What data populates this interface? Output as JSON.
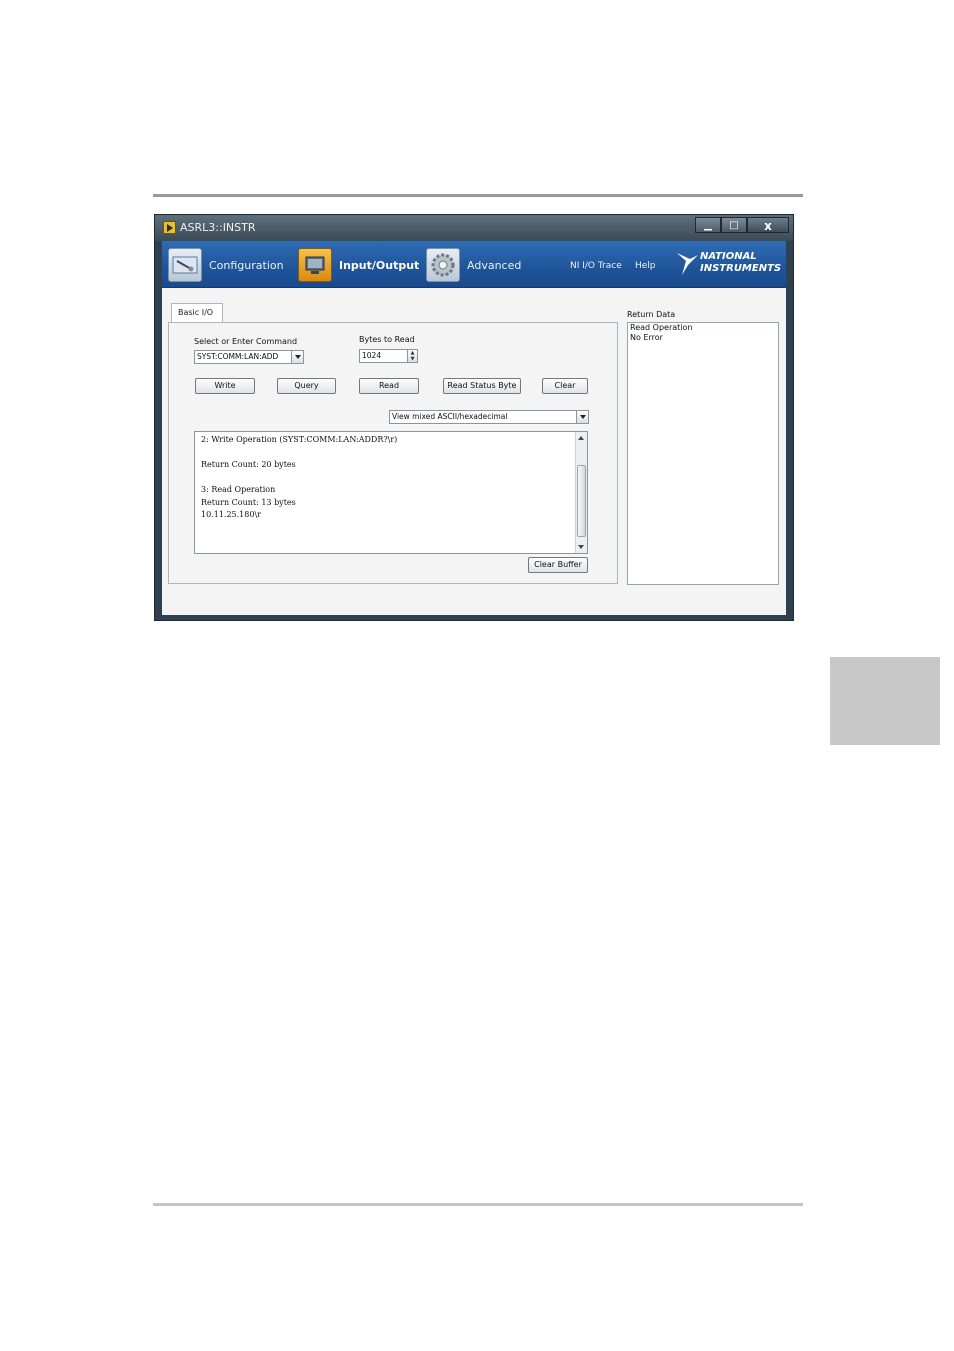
{
  "window": {
    "title": "ASRL3::INSTR",
    "controls": {
      "minimize": "▁",
      "maximize": "□",
      "close": "x"
    }
  },
  "nav": {
    "items": [
      {
        "label": "Configuration",
        "icon": "configuration-icon"
      },
      {
        "label": "Input/Output",
        "icon": "input-output-icon",
        "active": true
      },
      {
        "label": "Advanced",
        "icon": "gear-icon"
      }
    ],
    "links": [
      "NI I/O Trace",
      "Help"
    ],
    "logo": {
      "line1": "NATIONAL",
      "line2": "INSTRUMENTS"
    }
  },
  "tabs": [
    "Basic I/O"
  ],
  "basic_io": {
    "command_label": "Select or Enter Command",
    "command_value": "SYST:COMM:LAN:ADD",
    "bytes_label": "Bytes to Read",
    "bytes_value": "1024",
    "buttons": [
      "Write",
      "Query",
      "Read",
      "Read Status Byte",
      "Clear"
    ],
    "view_mode": "View mixed ASCII/hexadecimal",
    "buffer_text": "2: Write Operation (SYST:COMM:LAN:ADDR?\\r)\n\nReturn Count: 20 bytes\n\n3: Read Operation\nReturn Count: 13 bytes\n10.11.25.180\\r",
    "clear_buffer_label": "Clear Buffer"
  },
  "return_data": {
    "label": "Return Data",
    "lines": [
      "Read Operation",
      "No Error"
    ]
  },
  "colors": {
    "nav_blue": "#1f549a",
    "active_nav": "#e8a322",
    "window_frame": "#2f4150"
  }
}
